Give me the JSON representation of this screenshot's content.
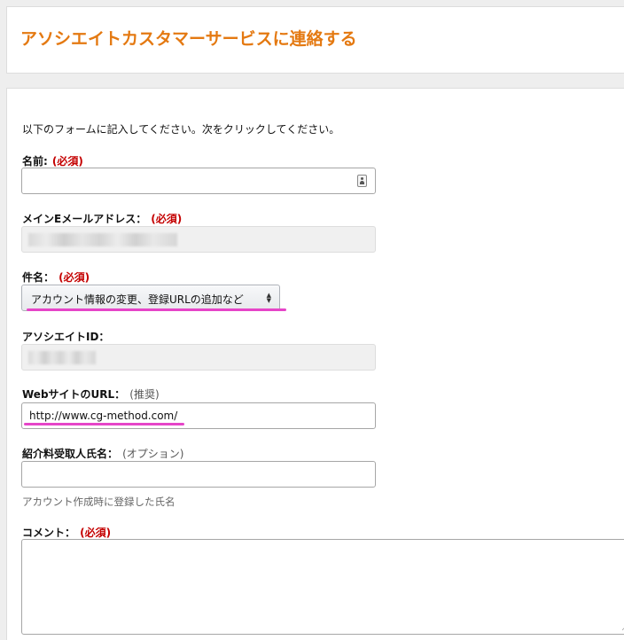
{
  "header": {
    "title": "アソシエイトカスタマーサービスに連絡する"
  },
  "form": {
    "intro": "以下のフォームに記入してください。次をクリックしてください。",
    "name": {
      "label": "名前:",
      "required": "(必須)",
      "value": ""
    },
    "email": {
      "label": "メインEメールアドレス：",
      "required": "(必須)"
    },
    "subject": {
      "label": "件名：",
      "required": "(必須)",
      "selected": "アカウント情報の変更、登録URLの追加など"
    },
    "associate_id": {
      "label": "アソシエイトID："
    },
    "website": {
      "label": "WebサイトのURL：",
      "note": "(推奨)",
      "value": "http://www.cg-method.com/"
    },
    "recipient": {
      "label": "紹介料受取人氏名：",
      "note": "(オプション)",
      "hint": "アカウント作成時に登録した氏名",
      "value": ""
    },
    "comment": {
      "label": "コメント：",
      "required": "(必須)",
      "value": ""
    }
  },
  "colors": {
    "title": "#e47911",
    "required": "#c40000",
    "annotation": "#e645c8"
  },
  "icons": {
    "name_field": "contact-card-icon",
    "select": "up-down-arrows-icon"
  }
}
